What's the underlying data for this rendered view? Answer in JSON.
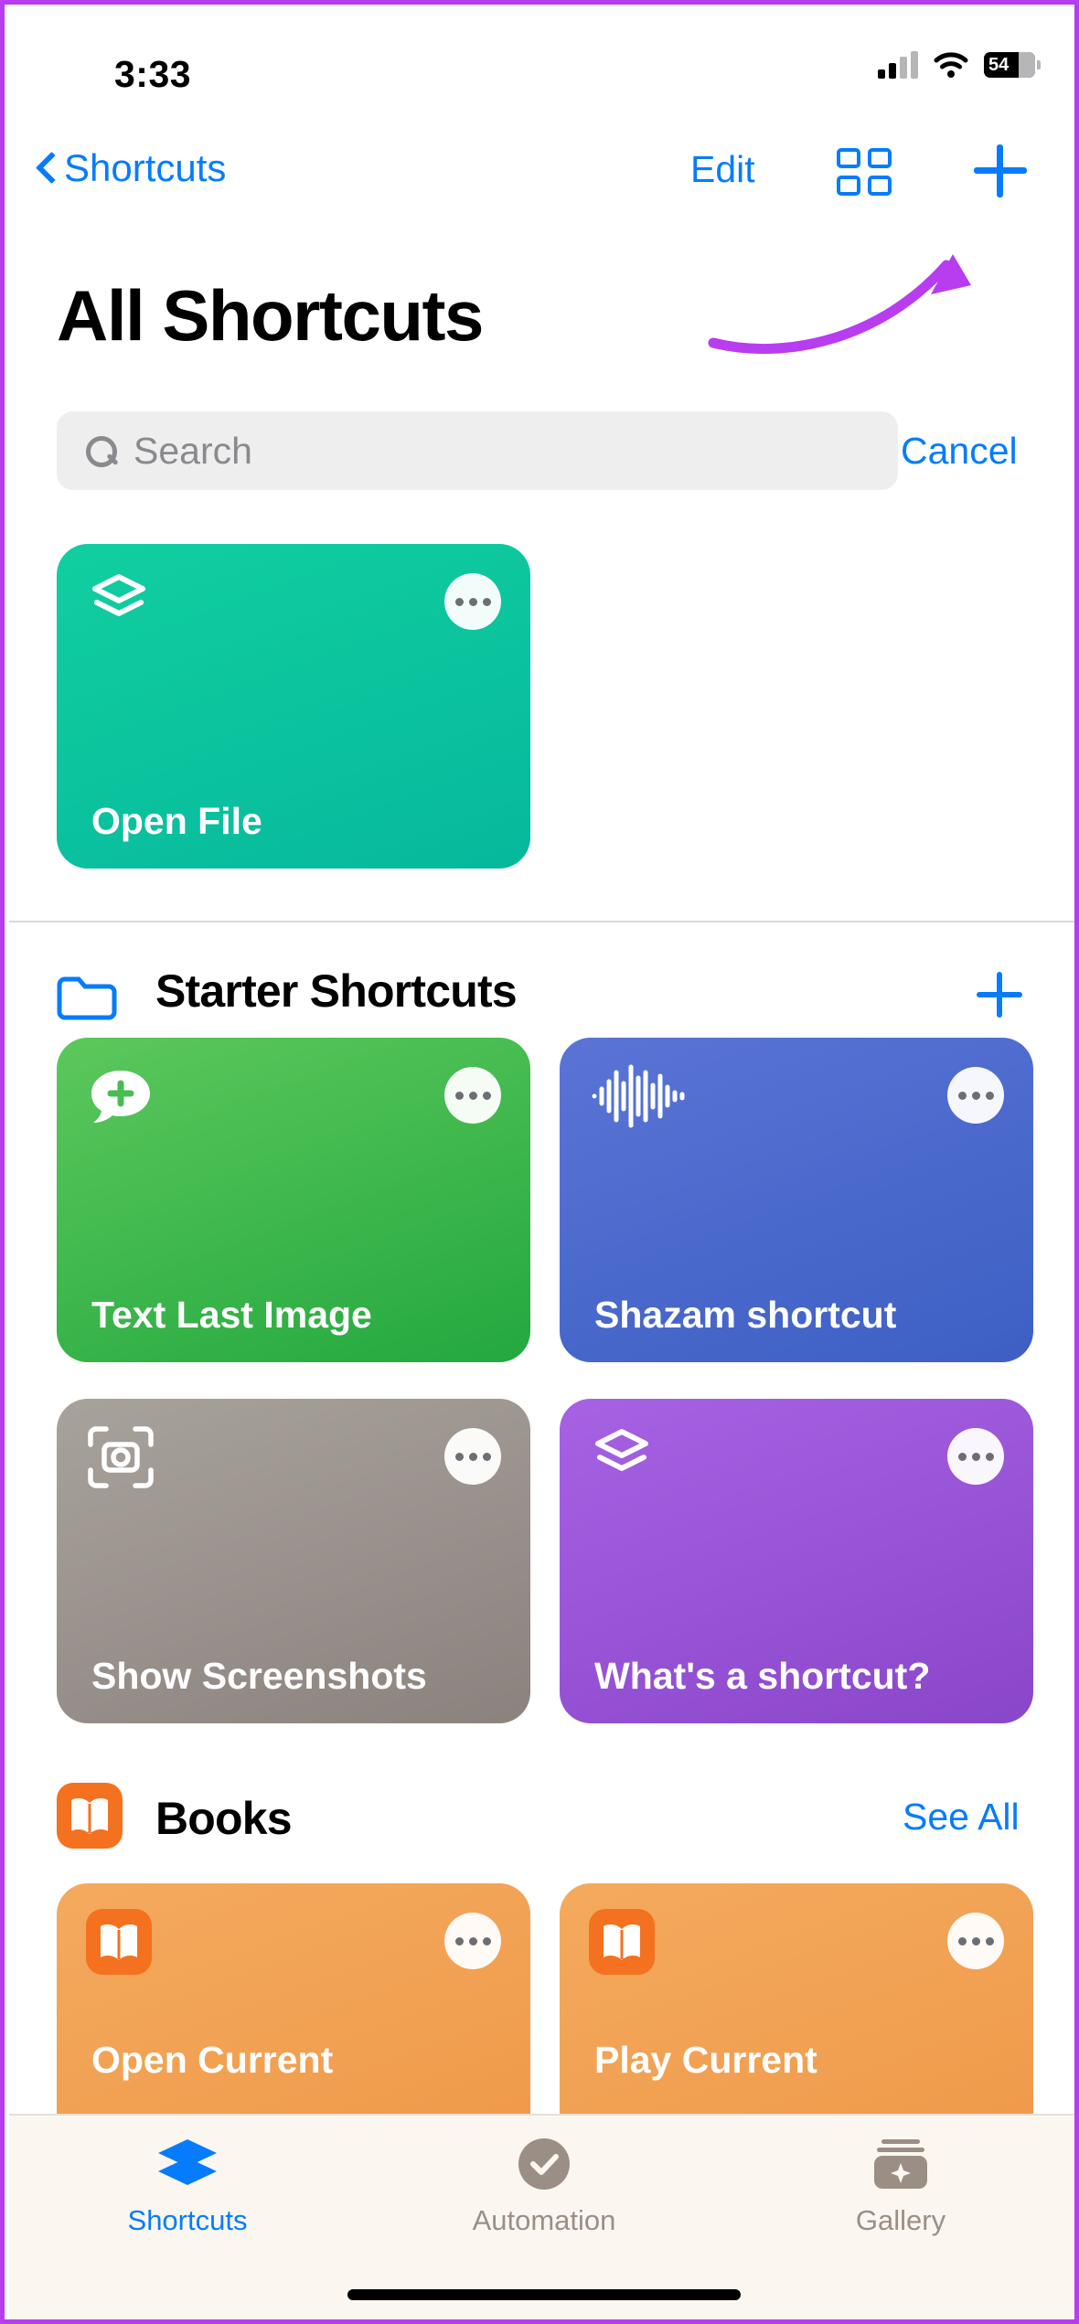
{
  "status_bar": {
    "time": "3:33",
    "battery_level": "54",
    "signal_icon": "cellular-signal-icon",
    "wifi_icon": "wifi-icon",
    "battery_icon": "battery-icon"
  },
  "nav_bar": {
    "back_label": "Shortcuts",
    "back_icon": "chevron-left-icon",
    "edit_label": "Edit",
    "grid_icon": "grid-view-icon",
    "add_icon": "plus-icon"
  },
  "page_title": "All Shortcuts",
  "search": {
    "value": "",
    "placeholder": "Search",
    "icon": "search-icon",
    "cancel_label": "Cancel"
  },
  "annotation": {
    "type": "curved-arrow",
    "color": "#b83cf0",
    "points_to": "plus-icon"
  },
  "all_shortcuts": [
    {
      "title": "Open File",
      "color_top": "#11cfa0",
      "color_bottom": "#06b89c",
      "icon": "shortcuts-stack-icon",
      "menu_icon": "ellipsis-icon"
    }
  ],
  "sections": [
    {
      "name": "Starter Shortcuts",
      "icon": "folder-icon",
      "action_icon": "plus-icon",
      "cards": [
        {
          "title": "Text Last Image",
          "color_top": "#5cc85c",
          "color_bottom": "#23a83f",
          "icon": "message-plus-icon",
          "menu_icon": "ellipsis-icon"
        },
        {
          "title": "Shazam shortcut",
          "color_top": "#5a74d6",
          "color_bottom": "#3d5fc4",
          "icon": "waveform-icon",
          "menu_icon": "ellipsis-icon"
        },
        {
          "title": "Show Screenshots",
          "color_top": "#a09a95",
          "color_bottom": "#8e8581",
          "icon": "screenshot-frame-icon",
          "menu_icon": "ellipsis-icon"
        },
        {
          "title": "What's a shortcut?",
          "color_top": "#a05ee0",
          "color_bottom": "#8a46c9",
          "icon": "shortcuts-stack-icon",
          "menu_icon": "ellipsis-icon"
        }
      ]
    },
    {
      "name": "Books",
      "icon": "books-app-icon",
      "action_label": "See All",
      "cards": [
        {
          "title": "Open Current",
          "color_top": "#f2a356",
          "color_bottom": "#ef9a4c",
          "icon": "books-app-icon",
          "menu_icon": "ellipsis-icon"
        },
        {
          "title": "Play Current",
          "color_top": "#f2a356",
          "color_bottom": "#ef9a4c",
          "icon": "books-app-icon",
          "menu_icon": "ellipsis-icon"
        }
      ]
    }
  ],
  "tab_bar": {
    "items": [
      {
        "label": "Shortcuts",
        "icon": "shortcuts-stack-icon",
        "active": true,
        "color": "#067cfc"
      },
      {
        "label": "Automation",
        "icon": "automation-check-icon",
        "active": false,
        "color": "#9b8f85"
      },
      {
        "label": "Gallery",
        "icon": "gallery-sparkle-icon",
        "active": false,
        "color": "#9b8f85"
      }
    ]
  },
  "colors": {
    "accent": "#067cfc",
    "annotation": "#b83cf0",
    "tab_bar_bg": "#fbf7f0",
    "search_bg": "#eeeeef"
  }
}
